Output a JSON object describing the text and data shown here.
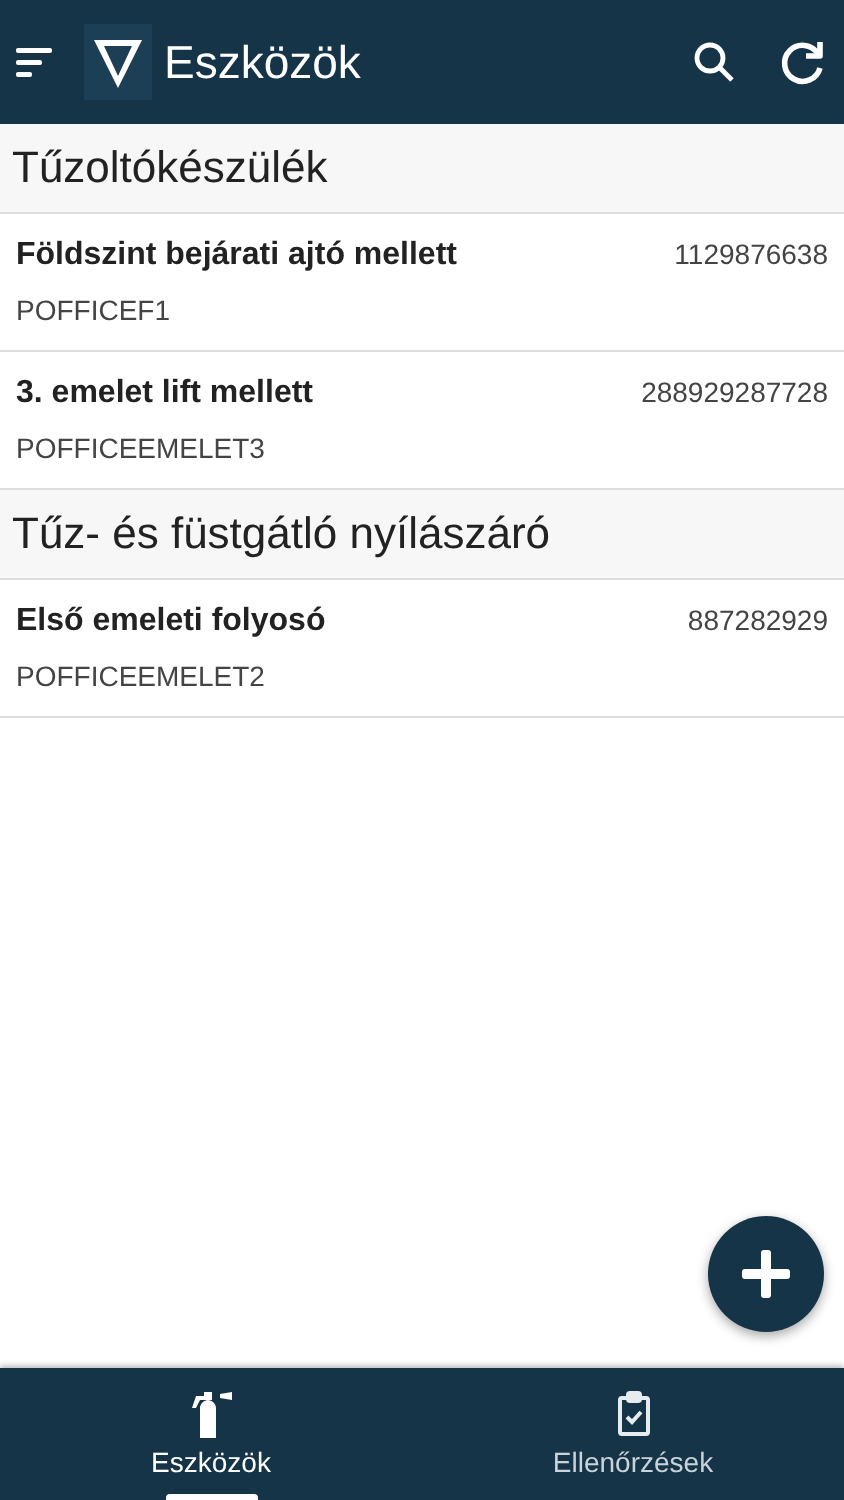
{
  "app_bar": {
    "title": "Eszközök"
  },
  "sections": [
    {
      "title": "Tűzoltókészülék",
      "items": [
        {
          "name": "Földszint bejárati ajtó mellett",
          "number": "1129876638",
          "code": "POFFICEF1"
        },
        {
          "name": "3. emelet lift mellett",
          "number": "288929287728",
          "code": "POFFICEEMELET3"
        }
      ]
    },
    {
      "title": "Tűz- és füstgátló nyílászáró",
      "items": [
        {
          "name": "Első emeleti folyosó",
          "number": "887282929",
          "code": "POFFICEEMELET2"
        }
      ]
    }
  ],
  "tabs": [
    {
      "label": "Eszközök",
      "kind": "extinguisher",
      "selected": true
    },
    {
      "label": "Ellenőrzések",
      "kind": "clipboard",
      "selected": false
    }
  ]
}
